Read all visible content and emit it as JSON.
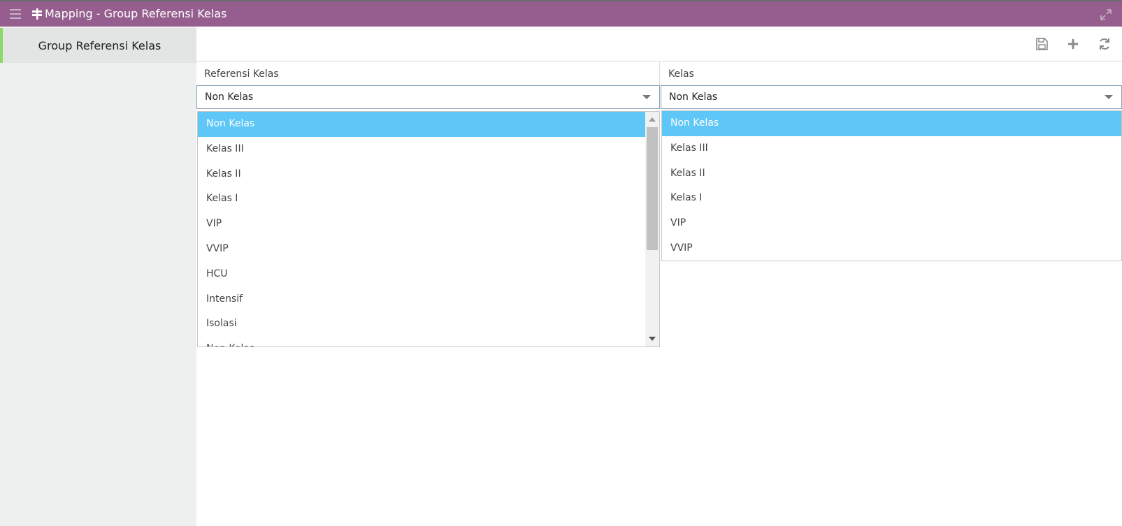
{
  "header": {
    "title": "Mapping - Group Referensi Kelas",
    "icons": {
      "menu": "hamburger-menu-icon",
      "title": "signpost-icon",
      "expand": "expand-icon"
    }
  },
  "sidebar": {
    "items": [
      {
        "label": "Group Referensi Kelas",
        "active": true
      }
    ]
  },
  "toolbar": {
    "icons": [
      "save-icon",
      "plus-icon",
      "refresh-icon"
    ]
  },
  "form": {
    "referensi_kelas": {
      "label": "Referensi Kelas",
      "value": "Non Kelas",
      "options": [
        "Non Kelas",
        "Kelas III",
        "Kelas II",
        "Kelas I",
        "VIP",
        "VVIP",
        "HCU",
        "Intensif",
        "Isolasi",
        "Non Kelas"
      ]
    },
    "kelas": {
      "label": "Kelas",
      "value": "Non Kelas",
      "options": [
        "Non Kelas",
        "Kelas III",
        "Kelas II",
        "Kelas I",
        "VIP",
        "VVIP"
      ]
    }
  },
  "colors": {
    "titlebar": "#955e8e",
    "selected_option": "#5fc7f7",
    "sidebar_active_border": "#8cd966"
  }
}
